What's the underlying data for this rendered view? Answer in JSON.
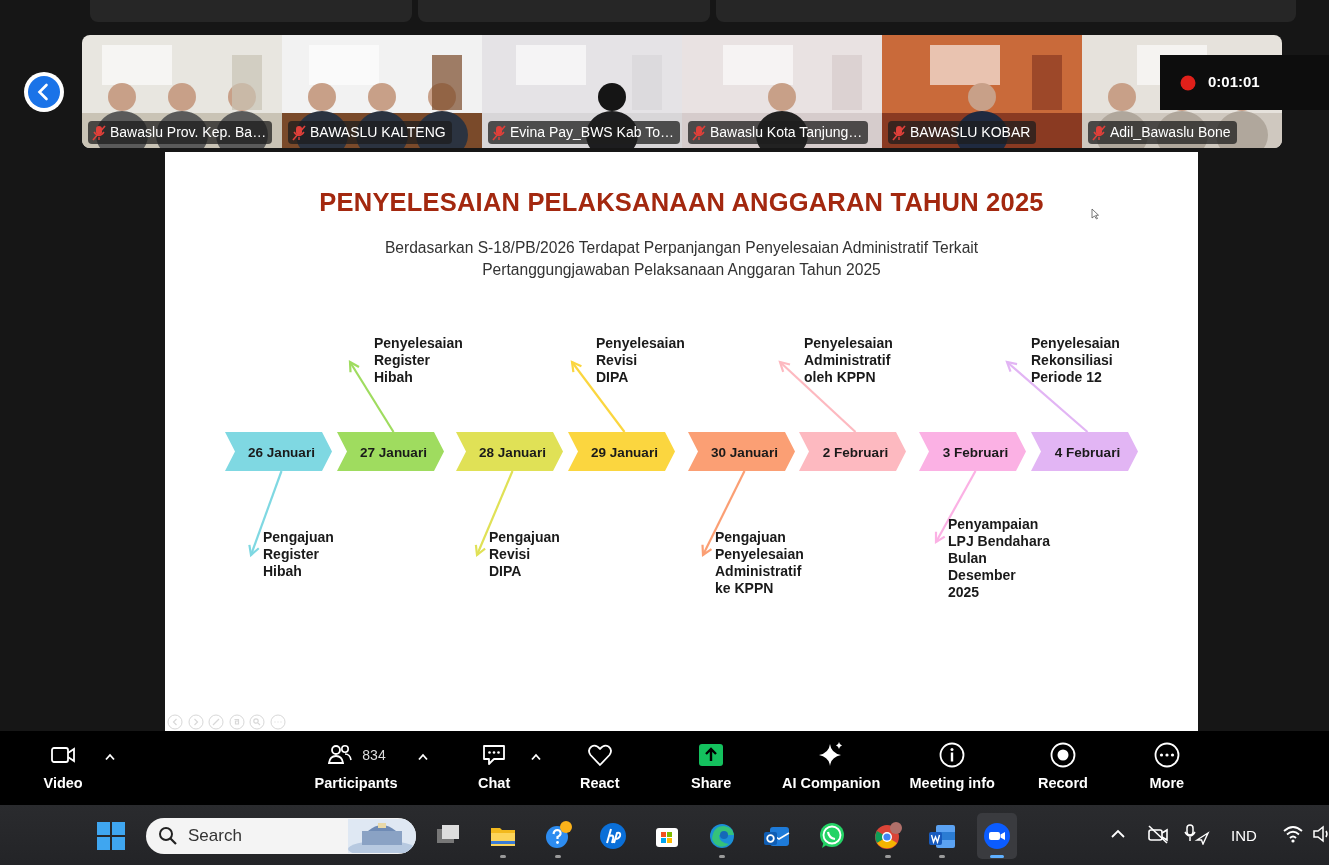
{
  "thumbnails": [
    {
      "name": "Bawaslu Prov. Kep. Ba…",
      "muted": true
    },
    {
      "name": "BAWASLU KALTENG",
      "muted": true
    },
    {
      "name": "Evina Pay_BWS Kab To…",
      "muted": true
    },
    {
      "name": "Bawaslu Kota Tanjung…",
      "muted": true
    },
    {
      "name": "BAWASLU KOBAR",
      "muted": true
    },
    {
      "name": "Adil_Bawaslu Bone",
      "muted": true
    }
  ],
  "recording": {
    "time": "0:01:01"
  },
  "slide": {
    "title": "PENYELESAIAN PELAKSANAAN ANGGARAN TAHUN 2025",
    "subtitle": "Berdasarkan S-18/PB/2026 Terdapat Perpanjangan Penyelesaian Administratif Terkait\nPertanggungjawaban Pelaksanaan Anggaran Tahun 2025",
    "steps": [
      {
        "date": "26 Januari",
        "color": "#7fd8e2",
        "note_below": "Pengajuan\nRegister\nHibah"
      },
      {
        "date": "27 Januari",
        "color": "#9fdc5f",
        "note_above": "Penyelesaian\nRegister\nHibah"
      },
      {
        "date": "28 Januari",
        "color": "#e0e156",
        "note_below": "Pengajuan\nRevisi\nDIPA"
      },
      {
        "date": "29 Januari",
        "color": "#fbd63f",
        "note_above": "Penyelesaian\nRevisi\nDIPA"
      },
      {
        "date": "30 Januari",
        "color": "#fb9f74",
        "note_below": "Pengajuan\nPenyelesaian\nAdministratif\nke KPPN"
      },
      {
        "date": "2 Februari",
        "color": "#fdb9c0",
        "note_above": "Penyelesaian\nAdministratif\noleh KPPN"
      },
      {
        "date": "3 Februari",
        "color": "#fbb1e4",
        "note_below": "Penyampaian\nLPJ Bendahara\nBulan\nDesember\n2025"
      },
      {
        "date": "4 Februari",
        "color": "#e2b5f4",
        "note_above": "Penyelesaian\nRekonsiliasi\nPeriode 12"
      }
    ]
  },
  "toolbar": [
    {
      "label": "Video",
      "caret": true
    },
    {
      "label": "Participants",
      "count": "834",
      "caret": true
    },
    {
      "label": "Chat",
      "caret": true
    },
    {
      "label": "React",
      "caret": false
    },
    {
      "label": "Share",
      "caret": false
    },
    {
      "label": "AI Companion",
      "caret": false
    },
    {
      "label": "Meeting info",
      "caret": false
    },
    {
      "label": "Record",
      "caret": false
    },
    {
      "label": "More",
      "caret": false
    }
  ],
  "taskbar": {
    "search": {
      "placeholder": "Search"
    },
    "apps": [
      {
        "running": false,
        "selected": false
      },
      {
        "running": true,
        "selected": false
      },
      {
        "running": true,
        "selected": false
      },
      {
        "running": false,
        "selected": false
      },
      {
        "running": false,
        "selected": false
      },
      {
        "running": true,
        "selected": false
      },
      {
        "running": false,
        "selected": false
      },
      {
        "running": false,
        "selected": false
      },
      {
        "running": true,
        "selected": false
      },
      {
        "running": true,
        "selected": false
      },
      {
        "running": true,
        "selected": true
      }
    ],
    "language": "IND"
  }
}
